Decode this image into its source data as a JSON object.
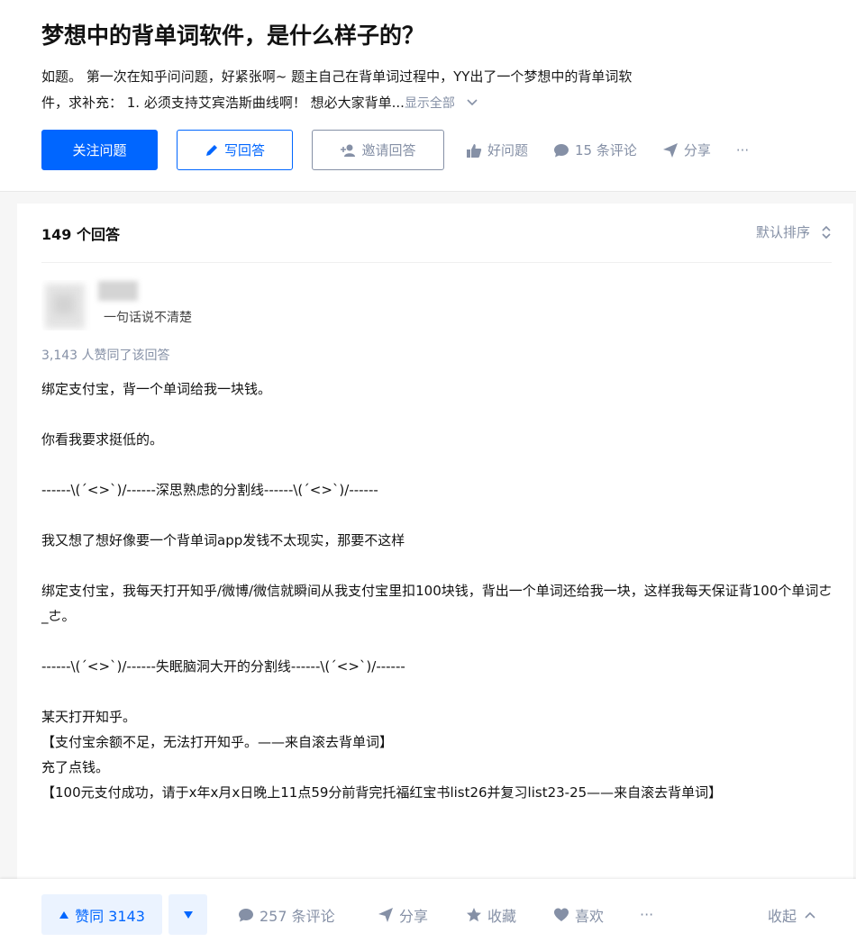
{
  "question": {
    "title": "梦想中的背单词软件，是什么样子的？",
    "description_line1": "如题。 第一次在知乎问问题，好紧张啊~ 题主自己在背单词过程中，YY出了一个梦想中的背单词软",
    "description_line2": "件，求补充： 1. 必须支持艾宾浩斯曲线啊！ 想必大家背单...",
    "show_all": "显示全部",
    "actions": {
      "follow": "关注问题",
      "write_answer": "写回答",
      "invite": "邀请回答",
      "good_question": "好问题",
      "comments": "15 条评论",
      "share": "分享",
      "more": "···"
    }
  },
  "answers": {
    "count_label": "149 个回答",
    "sort_label": "默认排序"
  },
  "answer": {
    "headline": "一句话说不清楚",
    "voters": "3,143 人赞同了该回答",
    "paragraphs": [
      "绑定支付宝，背一个单词给我一块钱。",
      "",
      "你看我要求挺低的。",
      "",
      "------\\(ˊ<>ˋ)/------深思熟虑的分割线------\\(ˊ<>ˋ)/------",
      "",
      "我又想了想好像要一个背单词app发钱不太现实，那要不这样",
      "",
      "绑定支付宝，我每天打开知乎/微博/微信就瞬间从我支付宝里扣100块钱，背出一个单词还给我一块，这样我每天保证背100个单词ㄜ_ㄜ。",
      "",
      "------\\(ˊ<>ˋ)/------失眠脑洞大开的分割线------\\(ˊ<>ˋ)/------",
      "",
      "某天打开知乎。",
      "【支付宝余额不足，无法打开知乎。——来自滚去背单词】",
      "充了点钱。",
      "【100元支付成功，请于x年x月x日晚上11点59分前背完托福红宝书list26并复习list23-25——来自滚去背单词】"
    ]
  },
  "bottom_bar": {
    "upvote": "赞同 3143",
    "comments": "257 条评论",
    "share": "分享",
    "collect": "收藏",
    "like": "喜欢",
    "more": "···",
    "collapse": "收起"
  },
  "colors": {
    "brand_blue": "#0066ff",
    "muted_gray": "#8590a6",
    "upvote_bg": "#ebf3ff"
  }
}
